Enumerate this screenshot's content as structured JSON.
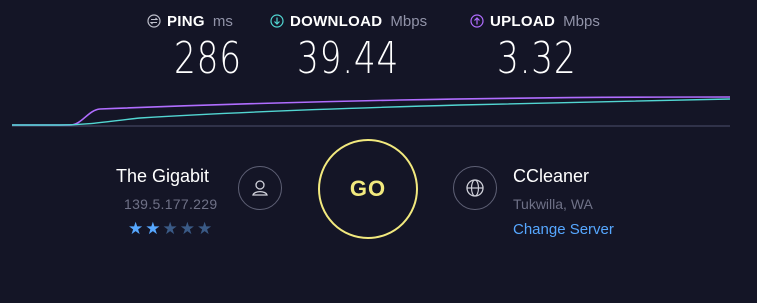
{
  "metrics": {
    "ping": {
      "label": "PING",
      "unit": "ms",
      "value": "286"
    },
    "download": {
      "label": "DOWNLOAD",
      "unit": "Mbps",
      "value": "39.44"
    },
    "upload": {
      "label": "UPLOAD",
      "unit": "Mbps",
      "value": "3.32"
    }
  },
  "isp": {
    "name": "The Gigabit",
    "ip": "139.5.177.229",
    "rating": 2,
    "max_rating": 5
  },
  "go_button": {
    "label": "GO"
  },
  "server": {
    "name": "CCleaner",
    "location": "Tukwilla, WA",
    "change_label": "Change Server"
  },
  "icons": {
    "ping": "ping-icon",
    "download": "download-arrow-icon",
    "upload": "upload-arrow-icon",
    "user": "user-icon",
    "globe": "globe-icon",
    "star": "star-icon"
  },
  "colors": {
    "background": "#141526",
    "go_ring": "#f2e97e",
    "download": "#52d6d2",
    "upload": "#b06dff",
    "link": "#56a7ff",
    "star_on": "#56a7ff",
    "star_off": "#3a5a86"
  }
}
